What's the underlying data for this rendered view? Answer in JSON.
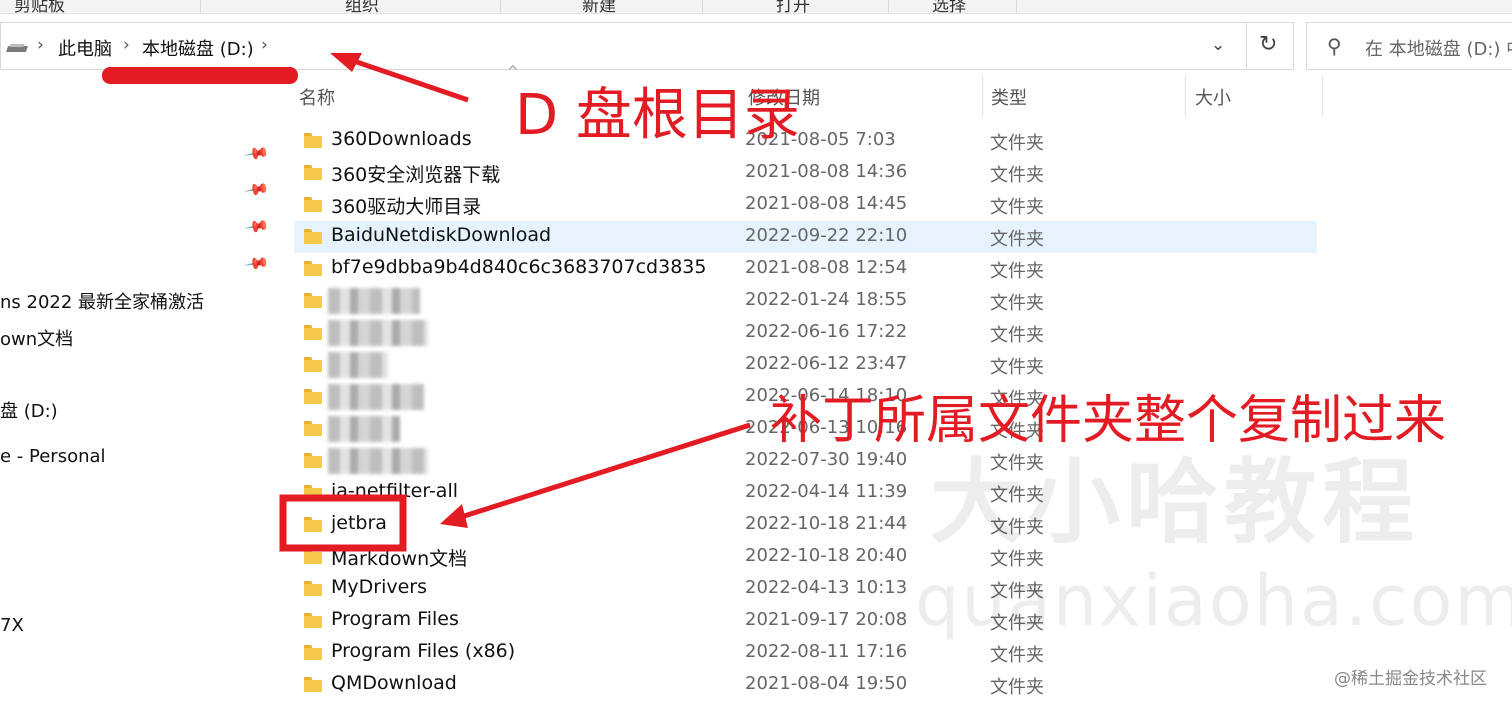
{
  "ribbon": {
    "groups": [
      "剪贴板",
      "组织",
      "新建",
      "打开",
      "选择"
    ]
  },
  "address_bar": {
    "crumbs": [
      "此电脑",
      "本地磁盘 (D:)"
    ],
    "search_placeholder": "在 本地磁盘 (D:) 中"
  },
  "nav_pane": {
    "items": [
      "ns  2022 最新全家桶激活",
      "own文档",
      "盘 (D:)",
      "e - Personal",
      "7X"
    ]
  },
  "columns": {
    "name": "名称",
    "date": "修改日期",
    "type": "类型",
    "size": "大小"
  },
  "files": [
    {
      "name": "360Downloads",
      "date": "2021-08-05 7:03",
      "type": "文件夹"
    },
    {
      "name": "360安全浏览器下载",
      "date": "2021-08-08 14:36",
      "type": "文件夹"
    },
    {
      "name": "360驱动大师目录",
      "date": "2021-08-08 14:45",
      "type": "文件夹"
    },
    {
      "name": "BaiduNetdiskDownload",
      "date": "2022-09-22 22:10",
      "type": "文件夹",
      "selected": true
    },
    {
      "name": "bf7e9dbba9b4d840c6c3683707cd3835",
      "date": "2021-08-08 12:54",
      "type": "文件夹"
    },
    {
      "name": "",
      "date": "2022-01-24 18:55",
      "type": "文件夹",
      "blurred": true
    },
    {
      "name": "",
      "date": "2022-06-16 17:22",
      "type": "文件夹",
      "blurred": true
    },
    {
      "name": "",
      "date": "2022-06-12 23:47",
      "type": "文件夹",
      "blurred": true
    },
    {
      "name": "",
      "date": "2022-06-14 18:10",
      "type": "文件夹",
      "blurred": true
    },
    {
      "name": "",
      "date": "2022-06-13 10:16",
      "type": "文件夹",
      "blurred": true
    },
    {
      "name": "",
      "date": "2022-07-30 19:40",
      "type": "文件夹",
      "blurred": true
    },
    {
      "name": "ja-netfilter-all",
      "date": "2022-04-14 11:39",
      "type": "文件夹"
    },
    {
      "name": "jetbra",
      "date": "2022-10-18 21:44",
      "type": "文件夹"
    },
    {
      "name": "Markdown文档",
      "date": "2022-10-18 20:40",
      "type": "文件夹"
    },
    {
      "name": "MyDrivers",
      "date": "2022-04-13 10:13",
      "type": "文件夹"
    },
    {
      "name": "Program Files",
      "date": "2021-09-17 20:08",
      "type": "文件夹"
    },
    {
      "name": "Program Files (x86)",
      "date": "2022-08-11 17:16",
      "type": "文件夹"
    },
    {
      "name": "QMDownload",
      "date": "2021-08-04 19:50",
      "type": "文件夹"
    }
  ],
  "annotations": {
    "top_label": "D 盘根目录",
    "middle_label": "补丁所属文件夹整个复制过来",
    "color": "#e31b23"
  },
  "watermark": {
    "cn": "大小哈教程",
    "en": "quanxiaoha.com"
  },
  "credit": "@稀土掘金技术社区",
  "icons": {
    "drive": "drive-icon",
    "folder": "folder-icon",
    "pin": "pin-icon",
    "refresh": "refresh-icon",
    "search": "search-icon",
    "dropdown": "chevron-down-icon"
  }
}
